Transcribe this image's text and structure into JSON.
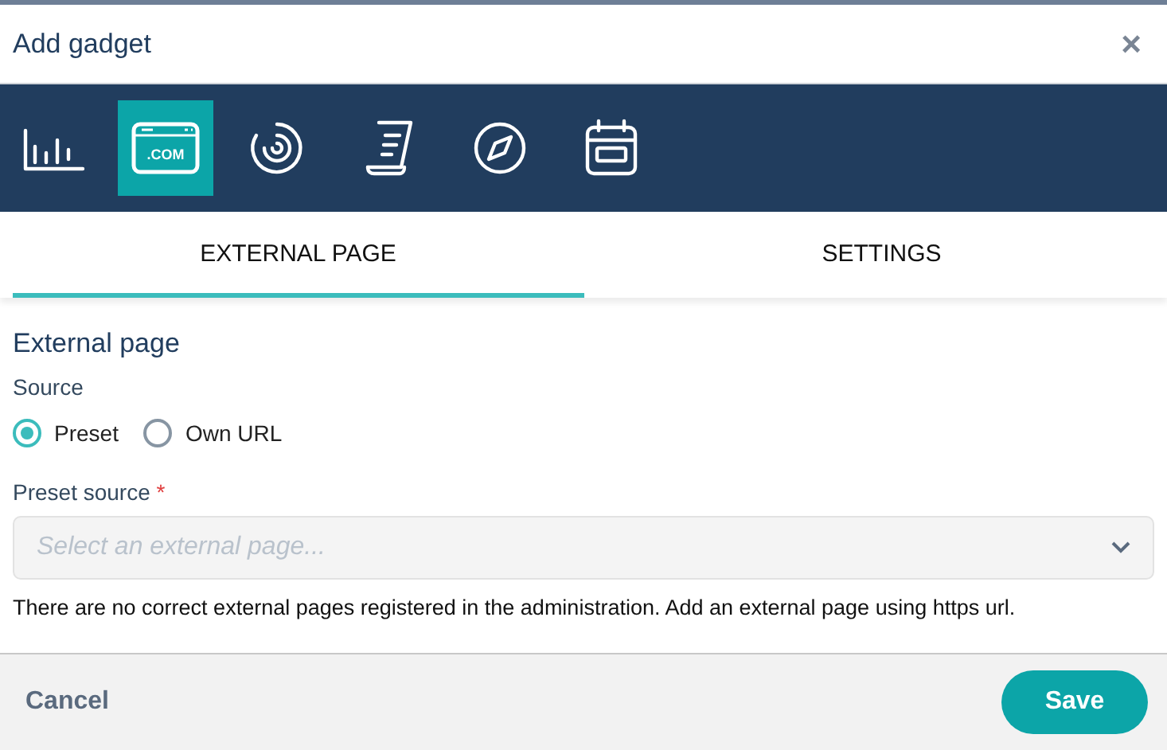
{
  "dialog": {
    "title": "Add gadget",
    "close": "×"
  },
  "gadget_types": [
    {
      "kind": "chart",
      "selected": false
    },
    {
      "kind": "web",
      "selected": true,
      "label": ".COM"
    },
    {
      "kind": "target",
      "selected": false
    },
    {
      "kind": "document",
      "selected": false
    },
    {
      "kind": "compass",
      "selected": false
    },
    {
      "kind": "calendar",
      "selected": false
    }
  ],
  "tabs": [
    {
      "label": "EXTERNAL PAGE",
      "selected": true
    },
    {
      "label": "SETTINGS",
      "selected": false
    }
  ],
  "section_title": "External page",
  "source": {
    "label": "Source",
    "options": [
      {
        "label": "Preset",
        "selected": true
      },
      {
        "label": "Own URL",
        "selected": false
      }
    ]
  },
  "preset_source": {
    "label": "Preset source",
    "required": "*",
    "placeholder": "Select an external page...",
    "help": "There are no correct external pages registered in the administration. Add an external page using https url."
  },
  "buttons": {
    "cancel": "Cancel",
    "save": "Save"
  }
}
